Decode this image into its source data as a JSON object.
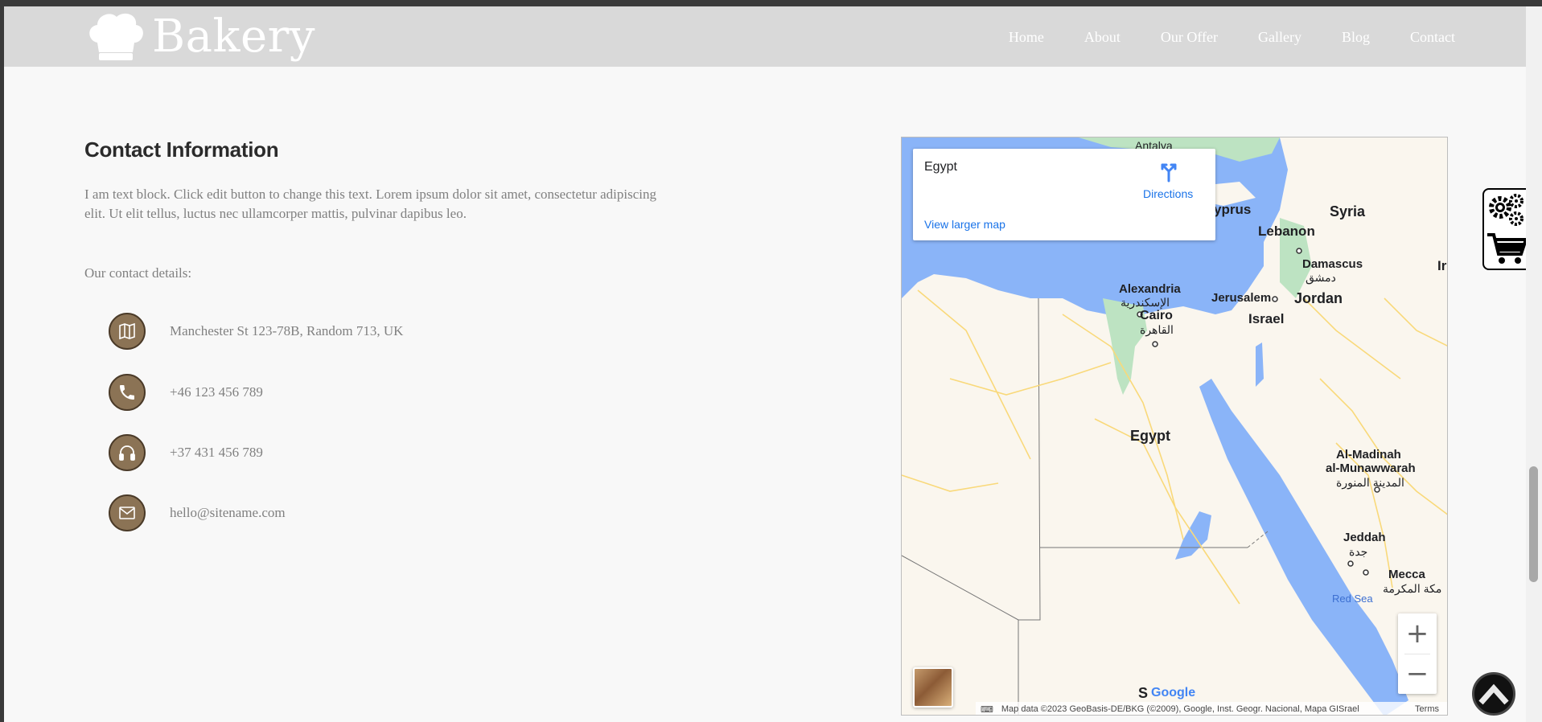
{
  "header": {
    "logo_text": "Bakery",
    "logo_icon": "chef-hat-icon",
    "nav": [
      "Home",
      "About",
      "Our Offer",
      "Gallery",
      "Blog",
      "Contact"
    ]
  },
  "contact": {
    "title": "Contact Information",
    "text": "I am text block. Click edit button to change this text. Lorem ipsum dolor sit amet, consectetur adipiscing elit. Ut elit tellus, luctus nec ullamcorper mattis, pulvinar dapibus leo.",
    "details_label": "Our contact details:",
    "items": [
      {
        "icon": "map-icon",
        "value": "Manchester St 123-78B, Random 713, UK"
      },
      {
        "icon": "phone-icon",
        "value": "+46 123 456 789"
      },
      {
        "icon": "headphones-icon",
        "value": "+37 431 456 789"
      },
      {
        "icon": "envelope-icon",
        "value": "hello@sitename.com"
      }
    ]
  },
  "map": {
    "card_place": "Egypt",
    "directions_label": "Directions",
    "view_larger": "View larger map",
    "zoom_in": "+",
    "zoom_out": "−",
    "attribution": "Map data ©2023 GeoBasis-DE/BKG (©2009), Google, Inst. Geogr. Nacional, Mapa GISrael",
    "terms": "Terms",
    "google": "Google",
    "labels": {
      "antalya": "Antalya",
      "cyprus": "yprus",
      "syria": "Syria",
      "lebanon": "Lebanon",
      "damascus": "Damascus",
      "damascus_ar": "دمشق",
      "alexandria": "Alexandria",
      "alexandria_ar": "الإسكندرية",
      "jerusalem": "Jerusalem",
      "jordan": "Jordan",
      "cairo": "Cairo",
      "cairo_ar": "القاهرة",
      "israel": "Israel",
      "egypt": "Egypt",
      "al_madinah": "Al-Madinah",
      "al_munawwarah": "al-Munawwarah",
      "madinah_ar": "المدينة المنورة",
      "jeddah": "Jeddah",
      "jeddah_ar": "جدة",
      "mecca": "Mecca",
      "mecca_ar": "مكة المكرمة",
      "red_sea": "Red Sea",
      "sudan": "S",
      "iraq": "Ir"
    },
    "colors": {
      "water": "#8ab4f8",
      "land": "#faf6ee",
      "green": "#bde3c2",
      "roads": "#f9d97a"
    }
  },
  "widgets": {
    "settings_icon": "gears-icon",
    "cart_icon": "shopping-cart-icon",
    "scroll_top_icon": "chevron-up-icon"
  }
}
